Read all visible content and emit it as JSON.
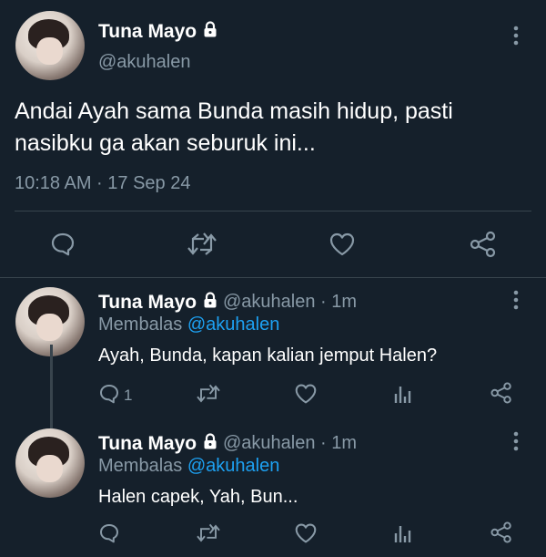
{
  "main_tweet": {
    "name": "Tuna Mayo",
    "handle": "@akuhalen",
    "text_line1": "Andai Ayah sama Bunda masih hidup, pasti",
    "text_line2": "nasibku ga akan seburuk ini...",
    "timestamp": "10:18 AM · 17 Sep 24",
    "actions": [
      "reply-icon",
      "retweet-icon",
      "like-icon",
      "share-icon"
    ]
  },
  "replies": [
    {
      "name": "Tuna Mayo",
      "handle_time": "@akuhalen · 1m",
      "replying_prefix": "Membalas",
      "replying_to": "@akuhalen",
      "text": "Ayah, Bunda, kapan kalian jemput Halen?",
      "reply_count": "1"
    },
    {
      "name": "Tuna Mayo",
      "handle_time": "@akuhalen · 1m",
      "replying_prefix": "Membalas",
      "replying_to": "@akuhalen",
      "text": "Halen capek, Yah, Bun...",
      "reply_count": ""
    }
  ],
  "colors": {
    "background": "#15202b",
    "secondary_text": "#8899a6",
    "accent": "#1da1f2",
    "divider": "#38444d"
  }
}
